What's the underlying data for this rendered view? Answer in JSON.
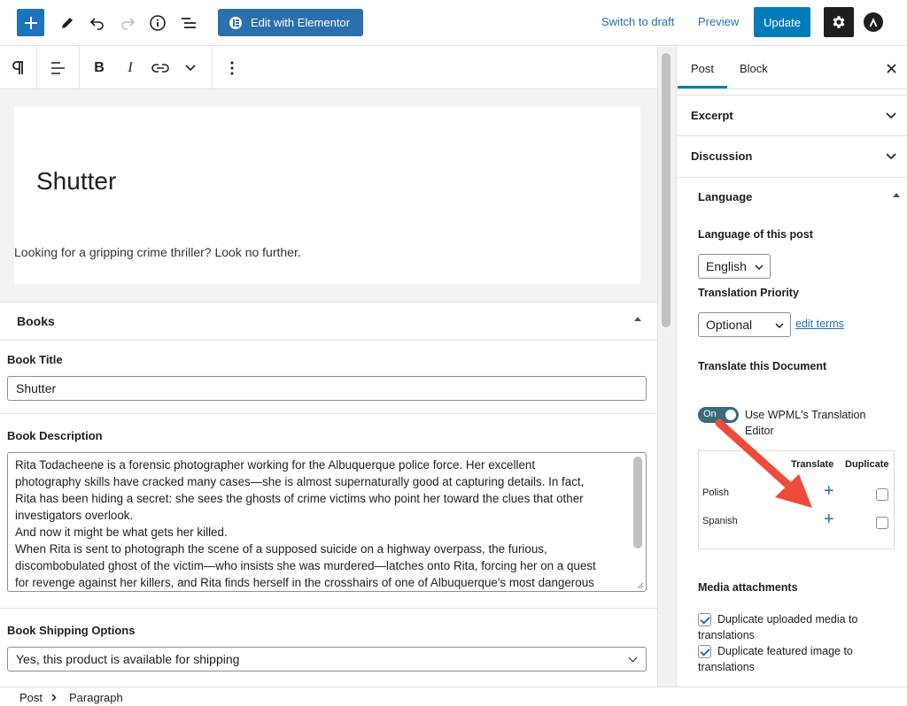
{
  "topbar": {
    "edit_with_elementor": "Edit with Elementor",
    "switch_to_draft": "Switch to draft",
    "preview": "Preview",
    "update": "Update"
  },
  "editor": {
    "post_title": "Shutter",
    "paragraph": "Looking for a gripping crime thriller? Look no further."
  },
  "books": {
    "header": "Books",
    "title_label": "Book Title",
    "title_value": "Shutter",
    "description_label": "Book Description",
    "description_lines": [
      "Rita Todacheene is a forensic photographer working for the Albuquerque police force. Her excellent",
      "photography skills have cracked many cases—she is almost supernaturally good at capturing details. In fact,",
      "Rita has been hiding a secret: she sees the ghosts of crime victims who point her toward the clues that other",
      "investigators overlook.",
      "And now it might be what gets her killed.",
      "When Rita is sent to photograph the scene of a supposed suicide on a highway overpass, the furious,",
      "discombobulated ghost of the victim—who insists she was murdered—latches onto Rita, forcing her on a quest",
      "for revenge against her killers, and Rita finds herself in the crosshairs of one of Albuquerque's most dangerous"
    ],
    "shipping_label": "Book Shipping Options",
    "shipping_value": "Yes, this product is available for shipping"
  },
  "sidebar": {
    "tab_post": "Post",
    "tab_block": "Block",
    "panel_excerpt": "Excerpt",
    "panel_discussion": "Discussion",
    "panel_language": "Language",
    "language_label": "Language of this post",
    "language_value": "English",
    "priority_label": "Translation Priority",
    "priority_value": "Optional",
    "edit_terms": "edit terms",
    "translate_doc_label": "Translate this Document",
    "toggle_on": "On",
    "toggle_label": "Use WPML's Translation Editor",
    "table_head_translate": "Translate",
    "table_head_duplicate": "Duplicate",
    "table_rows": [
      "Polish",
      "Spanish"
    ],
    "media_label": "Media attachments",
    "dup_media": "Duplicate uploaded media to translations",
    "dup_featured": "Duplicate featured image to translations"
  },
  "footer": {
    "crumb_post": "Post",
    "crumb_paragraph": "Paragraph"
  },
  "colors": {
    "accent": "#007cba",
    "elementor": "#2c6fad",
    "annotation_arrow": "#ee4b3a"
  }
}
